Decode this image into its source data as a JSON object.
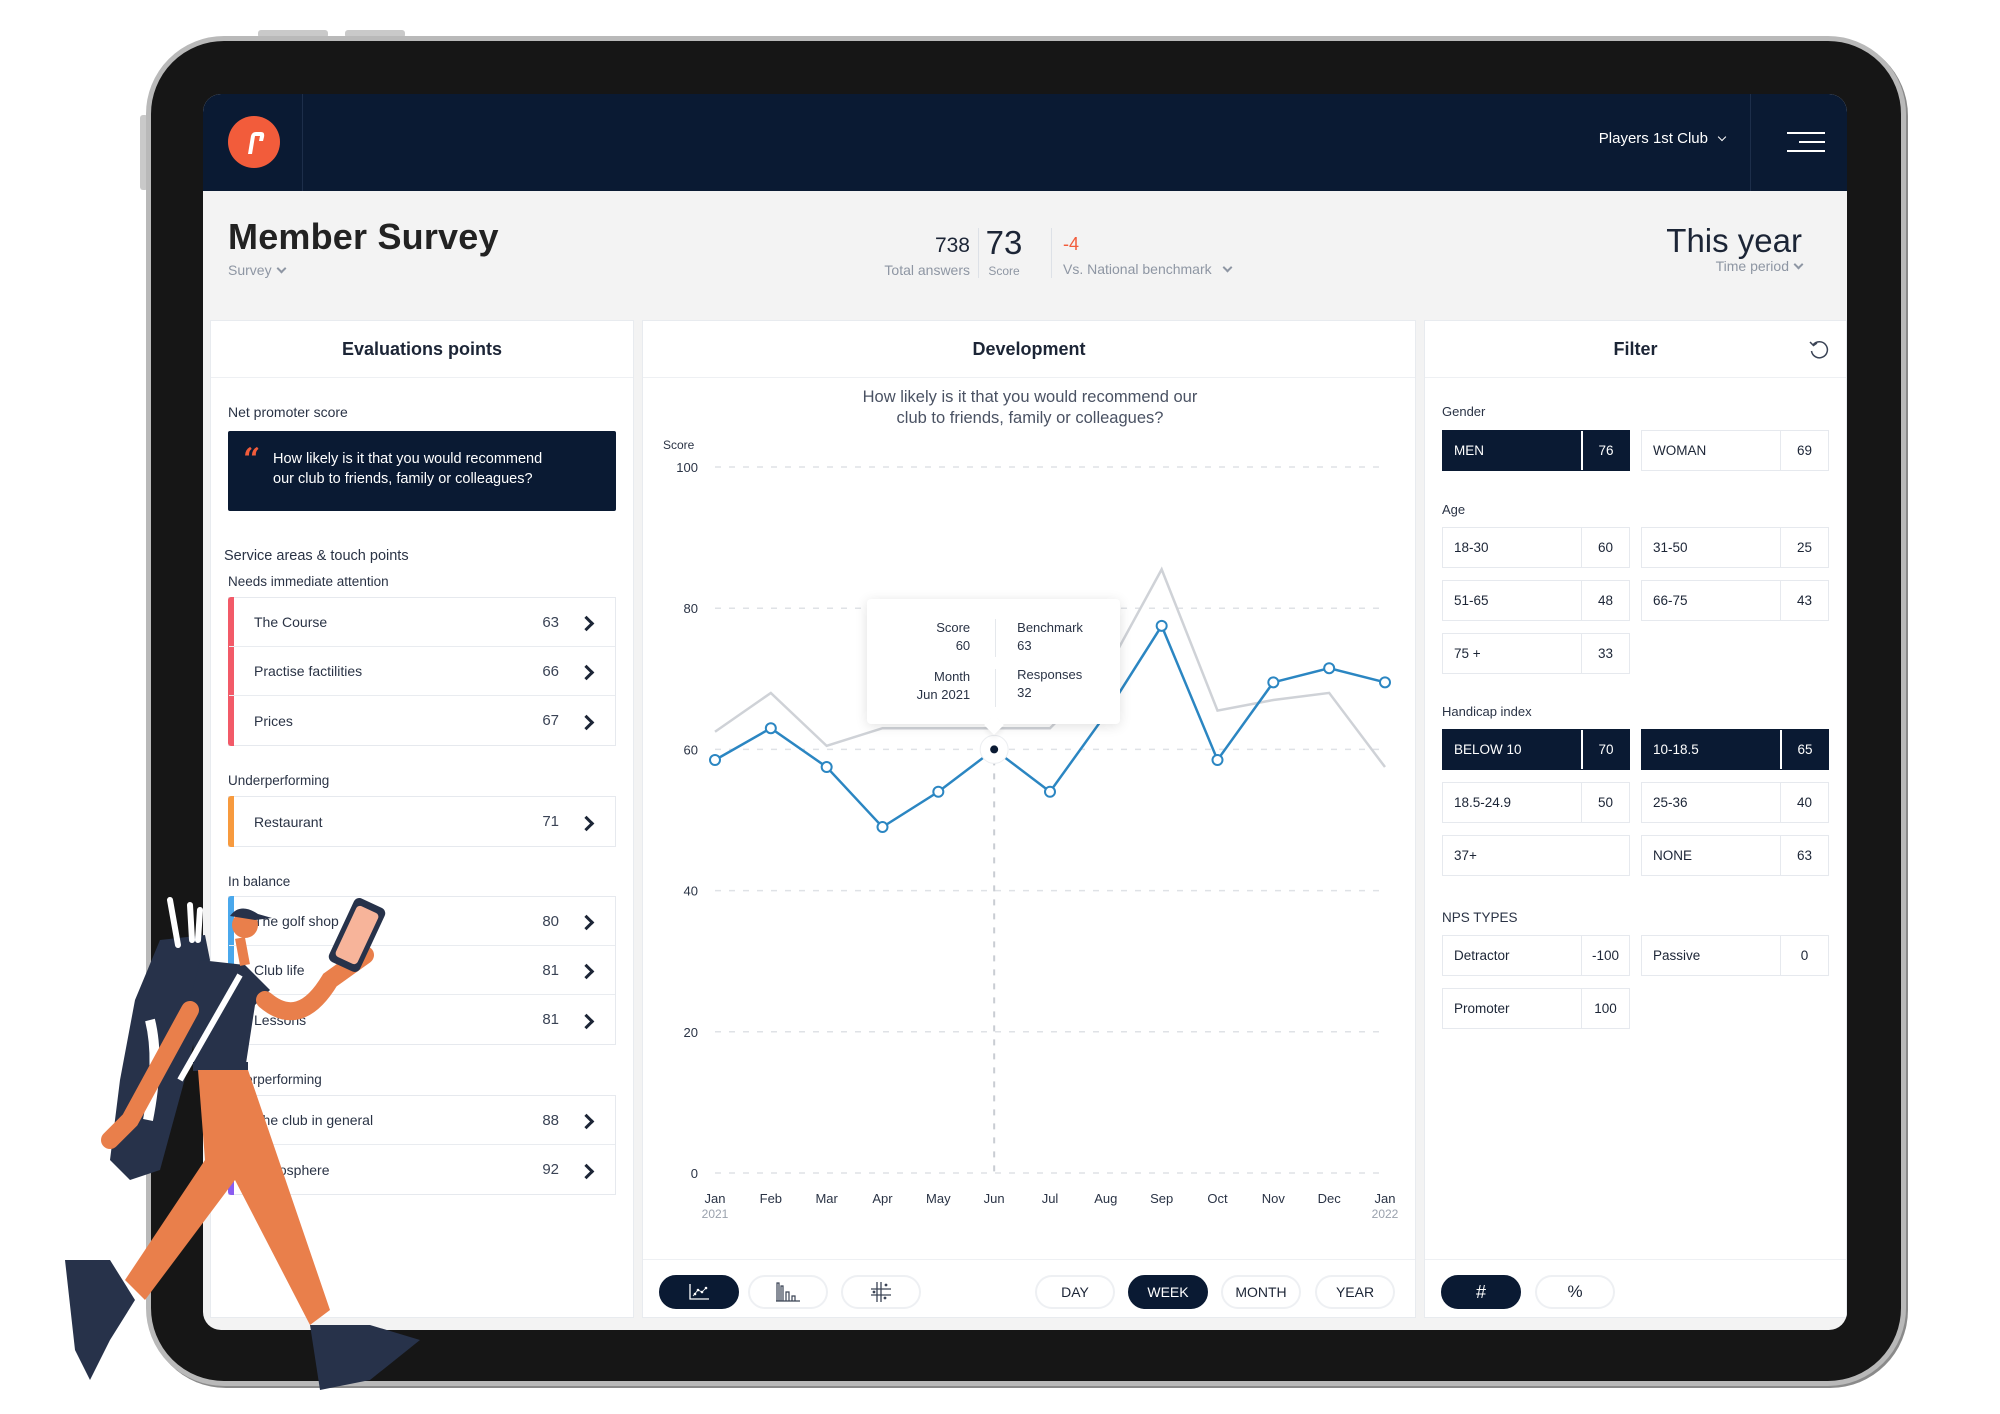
{
  "navbar": {
    "logo_icon": "players-1st-logo",
    "club_selector": "Players 1st Club",
    "menu_icon": "hamburger-menu-icon"
  },
  "header": {
    "title": "Member Survey",
    "survey_selector": "Survey",
    "total_answers": {
      "value": "738",
      "label": "Total answers"
    },
    "score": {
      "value": "73",
      "label": "Score"
    },
    "benchmark": {
      "value": "-4",
      "label": "Vs. National benchmark",
      "color": "#f25c3b"
    },
    "time_period": {
      "value": "This year",
      "label": "Time period"
    }
  },
  "evaluations": {
    "title": "Evaluations points",
    "nps_label": "Net promoter score",
    "nps_question_line1": "How likely is it that you would recommend",
    "nps_question_line2": "our club to friends, family or colleagues?",
    "service_label": "Service areas & touch points",
    "groups": [
      {
        "label": "Needs immediate attention",
        "color": "#f25a68",
        "items": [
          {
            "name": "The Course",
            "value": "63"
          },
          {
            "name": "Practise factilities",
            "value": "66"
          },
          {
            "name": "Prices",
            "value": "67"
          }
        ]
      },
      {
        "label": "Underperforming",
        "color": "#f79a3e",
        "items": [
          {
            "name": "Restaurant",
            "value": "71"
          }
        ]
      },
      {
        "label": "In balance",
        "color": "#4aa8ec",
        "items": [
          {
            "name": "The golf shop",
            "value": "80"
          },
          {
            "name": "Club life",
            "value": "81"
          },
          {
            "name": "Lessons",
            "value": "81"
          }
        ]
      },
      {
        "label": "Overperforming",
        "color": "#8a5cf0",
        "items": [
          {
            "name": "The club in general",
            "value": "88"
          },
          {
            "name": "Atmosphere",
            "value": "92"
          }
        ]
      }
    ]
  },
  "development": {
    "title": "Development",
    "question_line1": "How likely is it that you would recommend our",
    "question_line2": "club to friends, family or colleagues?",
    "tooltip": {
      "score_label": "Score",
      "score_value": "60",
      "benchmark_label": "Benchmark",
      "benchmark_value": "63",
      "month_label": "Month",
      "month_value": "Jun 2021",
      "responses_label": "Responses",
      "responses_value": "32"
    },
    "chart_type_buttons": [
      {
        "icon": "line-chart-icon",
        "active": true
      },
      {
        "icon": "bar-chart-icon",
        "active": false
      },
      {
        "icon": "scatter-grid-icon",
        "active": false
      }
    ],
    "granularity": [
      {
        "label": "DAY",
        "active": false
      },
      {
        "label": "WEEK",
        "active": true
      },
      {
        "label": "MONTH",
        "active": false
      },
      {
        "label": "YEAR",
        "active": false
      }
    ]
  },
  "chart_data": {
    "type": "line",
    "title": "How likely is it that you would recommend our club to friends, family or colleagues?",
    "ylabel": "Score",
    "xlabel": "",
    "ylim": [
      0,
      100
    ],
    "yticks": [
      0,
      20,
      40,
      60,
      80,
      100
    ],
    "grid": true,
    "categories": [
      "Jan",
      "Feb",
      "Mar",
      "Apr",
      "May",
      "Jun",
      "Jul",
      "Aug",
      "Sep",
      "Oct",
      "Nov",
      "Dec",
      "Jan"
    ],
    "category_sublabels": [
      "2021",
      "",
      "",
      "",
      "",
      "",
      "",
      "",
      "",
      "",
      "",
      "",
      "2022"
    ],
    "series": [
      {
        "name": "Score",
        "color": "#2b86c2",
        "values": [
          58.5,
          63,
          57.5,
          49,
          54,
          60,
          54,
          65,
          77.5,
          58.5,
          69.5,
          71.5,
          69.5
        ]
      },
      {
        "name": "Benchmark",
        "color": "#cfd2d7",
        "values": [
          62.5,
          68,
          60.5,
          63,
          63,
          63,
          63,
          71,
          85.5,
          65.5,
          67,
          68,
          57.5
        ]
      }
    ],
    "highlight": {
      "index": 5,
      "label": "Jun 2021",
      "score": 60,
      "benchmark": 63,
      "responses": 32
    }
  },
  "filter": {
    "title": "Filter",
    "reset_icon": "reset-icon",
    "sections": [
      {
        "label": "Gender",
        "chips": [
          {
            "label": "MEN",
            "value": "76",
            "active": true
          },
          {
            "label": "WOMAN",
            "value": "69",
            "active": false
          }
        ]
      },
      {
        "label": "Age",
        "chips": [
          {
            "label": "18-30",
            "value": "60",
            "active": false
          },
          {
            "label": "31-50",
            "value": "25",
            "active": false
          },
          {
            "label": "51-65",
            "value": "48",
            "active": false
          },
          {
            "label": "66-75",
            "value": "43",
            "active": false
          },
          {
            "label": "75 +",
            "value": "33",
            "active": false
          }
        ]
      },
      {
        "label": "Handicap index",
        "chips": [
          {
            "label": "BELOW 10",
            "value": "70",
            "active": true
          },
          {
            "label": "10-18.5",
            "value": "65",
            "active": true
          },
          {
            "label": "18.5-24.9",
            "value": "50",
            "active": false
          },
          {
            "label": "25-36",
            "value": "40",
            "active": false
          },
          {
            "label": "37+",
            "value": null,
            "active": false
          },
          {
            "label": "NONE",
            "value": "63",
            "active": false
          }
        ]
      },
      {
        "label": "NPS TYPES",
        "chips": [
          {
            "label": "Detractor",
            "value": "-100",
            "active": false
          },
          {
            "label": "Passive",
            "value": "0",
            "active": false
          },
          {
            "label": "Promoter",
            "value": "100",
            "active": false
          }
        ]
      }
    ],
    "units": [
      {
        "label": "#",
        "active": true
      },
      {
        "label": "%",
        "active": false
      }
    ]
  }
}
